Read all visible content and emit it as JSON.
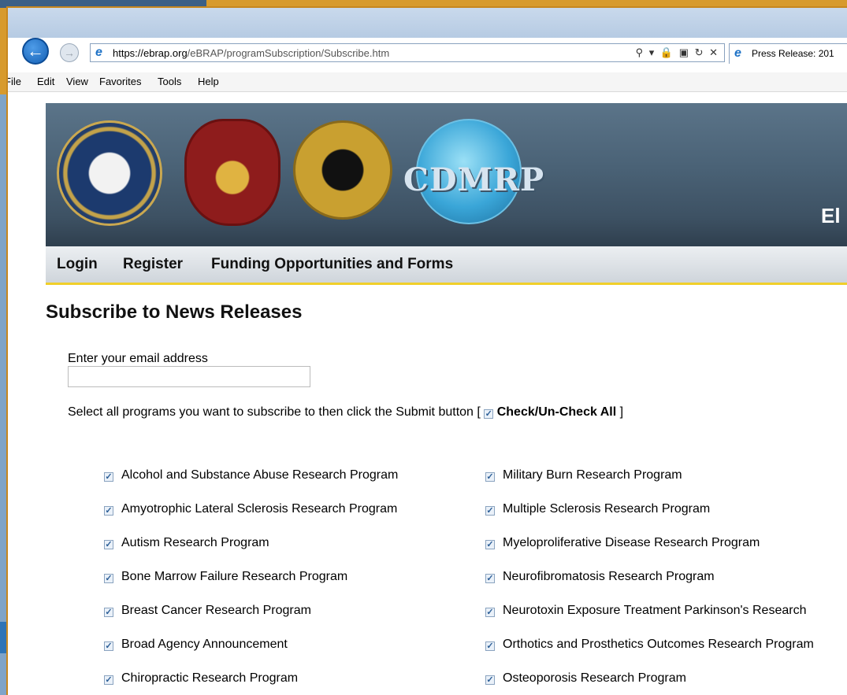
{
  "browser": {
    "url_host": "https://ebrap.org",
    "url_path": "/eBRAP/programSubscription/Subscribe.htm",
    "address_icons": "⚲ ▾ 🔒 ▣ ↻ ✕",
    "tab_title": "Press Release: 201",
    "menu": [
      "File",
      "Edit",
      "View",
      "Favorites",
      "Tools",
      "Help"
    ]
  },
  "banner": {
    "cdmrp_text": "CDMRP",
    "cut_text": "El"
  },
  "nav": [
    "Login",
    "Register",
    "Funding Opportunities and Forms"
  ],
  "page": {
    "heading": "Subscribe to News Releases",
    "email_label": "Enter your email address",
    "email_value": "",
    "select_text": "Select all programs you want to subscribe to then click the Submit button [ ",
    "check_all_label": "Check/Un-Check All",
    "select_close": " ]"
  },
  "programs_left": [
    "Alcohol and Substance Abuse Research Program",
    "Amyotrophic Lateral Sclerosis Research Program",
    "Autism Research Program",
    "Bone Marrow Failure Research Program",
    "Breast Cancer Research Program",
    "Broad Agency Announcement",
    "Chiropractic Research Program"
  ],
  "programs_right": [
    "Military Burn Research Program",
    "Multiple Sclerosis Research Program",
    "Myeloproliferative Disease Research Program",
    "Neurofibromatosis Research Program",
    "Neurotoxin Exposure Treatment Parkinson's Research",
    "Orthotics and Prosthetics Outcomes Research Program",
    "Osteoporosis Research Program"
  ],
  "checked_mark": "✓"
}
